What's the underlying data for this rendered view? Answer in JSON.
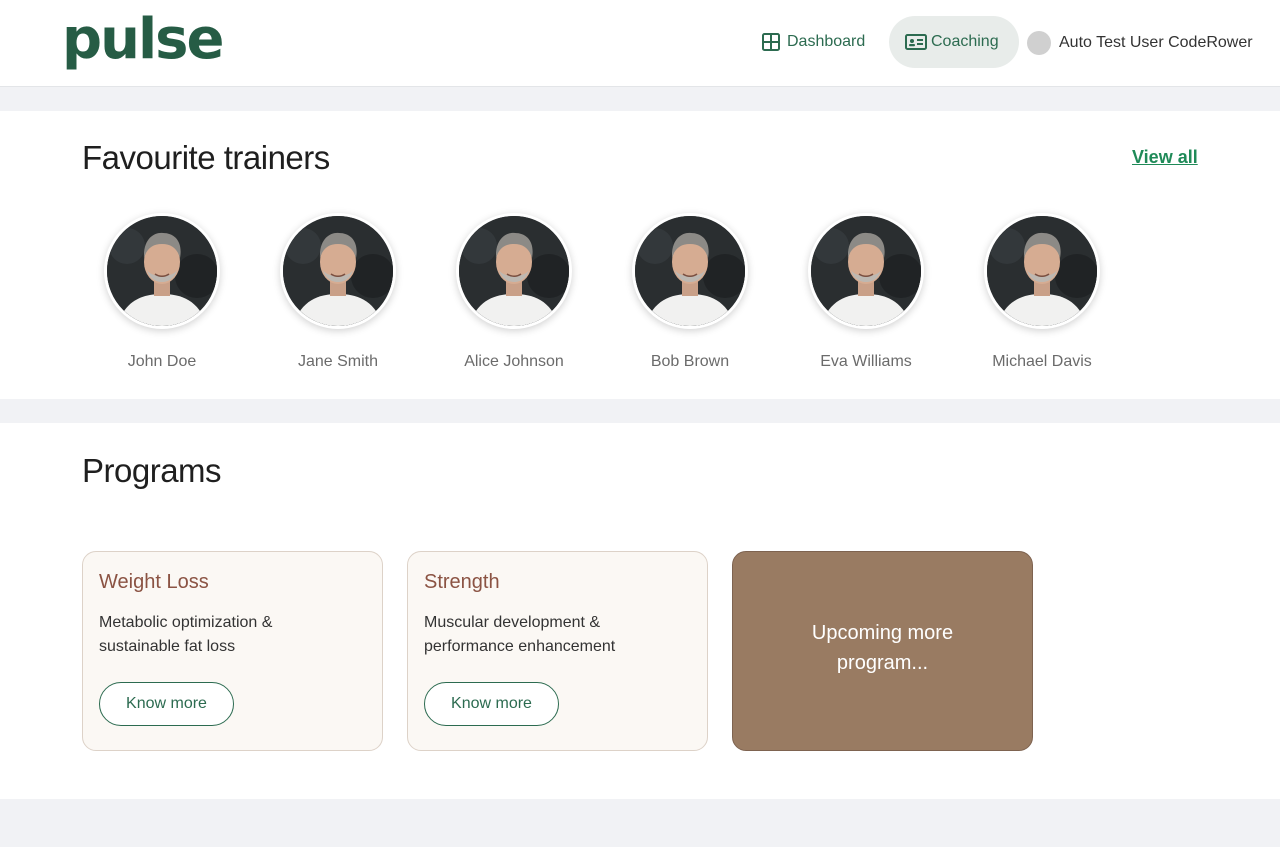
{
  "header": {
    "logo": "pulse",
    "nav": [
      {
        "label": "Dashboard",
        "icon": "grid-icon"
      },
      {
        "label": "Coaching",
        "icon": "id-card-icon"
      }
    ],
    "user_name": "Auto Test User CodeRower"
  },
  "trainers": {
    "title": "Favourite trainers",
    "view_all": "View all",
    "items": [
      {
        "name": "John Doe"
      },
      {
        "name": "Jane Smith"
      },
      {
        "name": "Alice Johnson"
      },
      {
        "name": "Bob Brown"
      },
      {
        "name": "Eva Williams"
      },
      {
        "name": "Michael Davis"
      }
    ]
  },
  "programs": {
    "title": "Programs",
    "cards": [
      {
        "title": "Weight Loss",
        "description": "Metabolic optimization & sustainable fat loss",
        "button": "Know more"
      },
      {
        "title": "Strength",
        "description": "Muscular development & performance enhancement",
        "button": "Know more"
      }
    ],
    "upcoming": "Upcoming more program..."
  },
  "colors": {
    "brand": "#265c45",
    "link": "#1f8a58",
    "card_title": "#8b5343",
    "upcoming_bg": "#997b62"
  }
}
